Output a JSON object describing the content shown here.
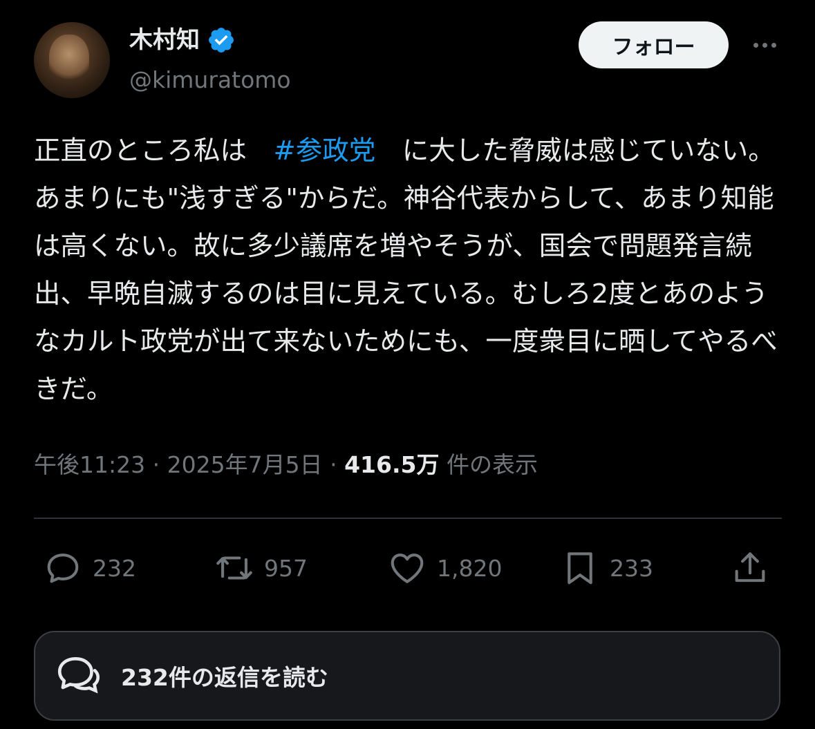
{
  "author": {
    "display_name": "木村知",
    "handle": "@kimuratomo",
    "verified_icon": "verified-badge-icon",
    "verified_color": "#1d9bf0"
  },
  "header": {
    "follow_label": "フォロー",
    "more_icon": "more-dots-icon"
  },
  "tweet": {
    "text_part1": "正直のところ私は　",
    "hashtag": "#参政党",
    "text_part2": "　に大した脅威は感じていない。あまりにも\"浅すぎる\"からだ。神谷代表からして、あまり知能は高くない。故に多少議席を増やそうが、国会で問題発言続出、早晩自滅するのは目に見えている。むしろ2度とあのようなカルト政党が出て来ないためにも、一度衆目に晒してやるべきだ。"
  },
  "meta": {
    "time": "午後11:23",
    "sep1": " · ",
    "date": "2025年7月5日",
    "sep2": " · ",
    "views": "416.5万",
    "views_label": " 件の表示"
  },
  "actions": {
    "reply_count": "232",
    "retweet_count": "957",
    "like_count": "1,820",
    "bookmark_count": "233"
  },
  "replies_button": {
    "label": "232件の返信を読む",
    "icon": "speech-bubbles-icon"
  },
  "colors": {
    "background": "#000000",
    "text": "#e7e9ea",
    "secondary": "#71767b",
    "accent": "#1d9bf0"
  }
}
